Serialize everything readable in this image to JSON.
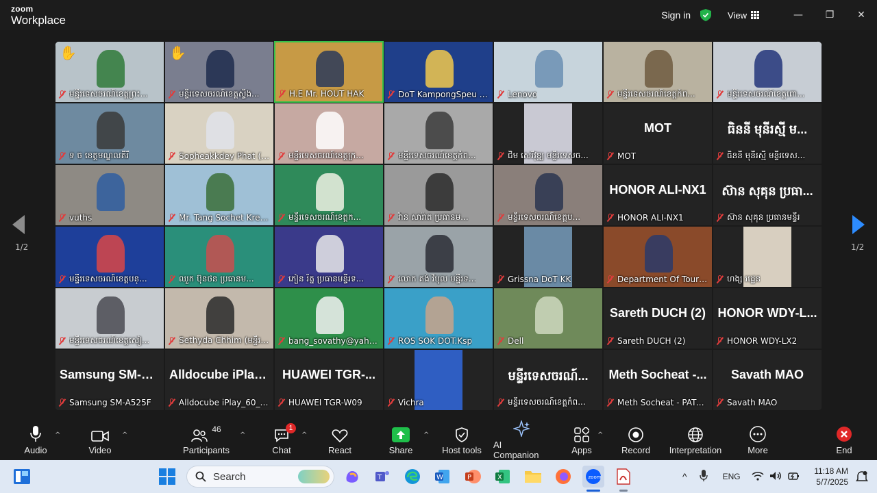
{
  "app": {
    "brand_small": "zoom",
    "brand_big": "Workplace",
    "sign_in": "Sign in",
    "view": "View"
  },
  "pager": {
    "left": "1/2",
    "right": "1/2"
  },
  "tiles": [
    {
      "name": "មន្ទីរទេសចរណ៍ខេត្តព្រះ...",
      "type": "video",
      "hand": true,
      "bg": "#b8c3c9",
      "pic": "#2f7a3a"
    },
    {
      "name": "មន្ទីរទេសចរណ៍ខេត្តស្ទឹង...",
      "type": "video",
      "hand": true,
      "bg": "#7a7e8f",
      "pic": "#1e2c4e"
    },
    {
      "name": "H.E Mr. HOUT HAK",
      "type": "video",
      "active": true,
      "bg": "#c79a45",
      "pic": "#2a3a5a"
    },
    {
      "name": "DoT KampongSpeu - ...",
      "type": "video",
      "bg": "#1f3f8a",
      "pic": "#f2c94c"
    },
    {
      "name": "Lenovo",
      "type": "video",
      "bg": "#c7d4dc",
      "pic": "#6b8fb3"
    },
    {
      "name": "មន្ទីរទេសចរណ៍ខេត្តកំព...",
      "type": "video",
      "bg": "#b9b2a0",
      "pic": "#6f5a40"
    },
    {
      "name": "មន្ទីរទេសចរណ៍ខេត្តពោ...",
      "type": "video",
      "bg": "#c7cdd4",
      "pic": "#23357a"
    },
    {
      "name": "ទ ច ខេត្តមណ្ឌលគិរី",
      "type": "video",
      "bg": "#6e8aa0",
      "pic": "#3a3a3a"
    },
    {
      "name": "Sopheakkdey Phat (Do...",
      "type": "video",
      "bg": "#d9d2c2",
      "pic": "#dfe3ea"
    },
    {
      "name": "មន្ទីរទេសចរណ៍ខេត្តក្រ...",
      "type": "video",
      "bg": "#c6a9a2",
      "pic": "#ffffff"
    },
    {
      "name": "មន្ទីរទេសចរណ៍ខេត្តកំព...",
      "type": "video",
      "bg": "#a9a9a9",
      "pic": "#3c3c3c"
    },
    {
      "name": "ជិម សេរីវុឌ្ឍ មន្ទីរទេសច...",
      "type": "portrait",
      "bg": "#232323",
      "pic": "#c9c9d3"
    },
    {
      "name": "MOT",
      "type": "text",
      "big": "MOT"
    },
    {
      "name": "ធិននី មុនីរស្មី មន្ទីរទេស...",
      "type": "text",
      "big": "ធិននី មុនីរស្មី ម..."
    },
    {
      "name": "vuths",
      "type": "video",
      "bg": "#8e8a84",
      "pic": "#2f5da0"
    },
    {
      "name": "Mr. Tang Sochet Kresna",
      "type": "video",
      "bg": "#9fc0d6",
      "pic": "#3b6e3a"
    },
    {
      "name": "មន្ទីរទេសចរណ៍ខេត្តក...",
      "type": "video",
      "bg": "#2f8a5a",
      "pic": "#eef1e4"
    },
    {
      "name": "វ៉ាន សារ៉ាត ប្រធានម...",
      "type": "video",
      "bg": "#9a9a9a",
      "pic": "#2b2b2b"
    },
    {
      "name": "មន្ទីរទេសចរណ៍ខេត្តប...",
      "type": "video",
      "bg": "#8a7f7a",
      "pic": "#2a3550"
    },
    {
      "name": "HONOR ALI-NX1",
      "type": "text",
      "big": "HONOR ALI-NX1"
    },
    {
      "name": "ស៊ាន សុគុន ប្រធានមន្ទីរ",
      "type": "text",
      "big": "ស៊ាន សុគុន ប្រធា..."
    },
    {
      "name": "មន្ទីរទេសចរណ៍ខេត្តបន្...",
      "type": "video",
      "bg": "#1e3f9a",
      "pic": "#d94646"
    },
    {
      "name": "ឈួក ប៊ុនថន ប្រធានម...",
      "type": "video",
      "bg": "#2a8f7a",
      "pic": "#c94f4f"
    },
    {
      "name": "ភៀន រ័ត្ន ប្រធានមន្ទីរទ...",
      "type": "video",
      "bg": "#3a3a8a",
      "pic": "#e9e9e9"
    },
    {
      "name": "លោក គង់ វិបុល មន្ទីរទ...",
      "type": "video",
      "bg": "#9aa3a8",
      "pic": "#2b2e36"
    },
    {
      "name": "Grissna DoT KK",
      "type": "portrait",
      "bg": "#232323",
      "pic": "#6a8aa5"
    },
    {
      "name": "Department Of Touris...",
      "type": "video",
      "bg": "#8a4a2a",
      "pic": "#2a3a6a"
    },
    {
      "name": "ហង្ស រដ្ឋេន",
      "type": "portrait",
      "bg": "#232323",
      "pic": "#d8cfc0"
    },
    {
      "name": "មន្ទីរទេសចរណ៍ខេត្តសៀ...",
      "type": "video",
      "bg": "#c8ccd0",
      "pic": "#4a4a52"
    },
    {
      "name": "Sethyda Chhim (មន្ទីរទ...",
      "type": "video",
      "bg": "#c3b9ac",
      "pic": "#2a2a2a"
    },
    {
      "name": "bang_sovathy@yahoo....",
      "type": "video",
      "bg": "#2e8f4a",
      "pic": "#f2f2f2"
    },
    {
      "name": "ROS SOK DOT.Ksp",
      "type": "video",
      "bg": "#3aa0c8",
      "pic": "#c9a38a"
    },
    {
      "name": "Dell",
      "type": "video",
      "bg": "#6f8a5a",
      "pic": "#cfd8c0"
    },
    {
      "name": "Sareth DUCH (2)",
      "type": "text",
      "big": "Sareth DUCH (2)"
    },
    {
      "name": "HONOR WDY-LX2",
      "type": "text",
      "big": "HONOR  WDY-L..."
    },
    {
      "name": "Samsung SM-A525F",
      "type": "text",
      "big": "Samsung  SM-A..."
    },
    {
      "name": "Alldocube iPlay_60_Lite",
      "type": "text",
      "big": "Alldocube  iPlay..."
    },
    {
      "name": "HUAWEI TGR-W09",
      "type": "text",
      "big": "HUAWEI  TGR-..."
    },
    {
      "name": "Vichra",
      "type": "portrait",
      "bg": "#232323",
      "pic": "#2f5ec2"
    },
    {
      "name": "មន្ទីរទេសចរណ៍ខេត្តកំព...",
      "type": "text",
      "big": "មន្ទីរទេសចរណ៍..."
    },
    {
      "name": "Meth Socheat - PATA ...",
      "type": "text",
      "big": "Meth  Socheat  -..."
    },
    {
      "name": "Savath MAO",
      "type": "text",
      "big": "Savath MAO"
    }
  ],
  "toolbar": {
    "audio": "Audio",
    "video": "Video",
    "participants": "Participants",
    "participants_count": "46",
    "chat": "Chat",
    "chat_badge": "1",
    "react": "React",
    "share": "Share",
    "host_tools": "Host tools",
    "ai_companion": "AI Companion",
    "apps": "Apps",
    "record": "Record",
    "interpretation": "Interpretation",
    "more": "More",
    "end": "End"
  },
  "taskbar": {
    "search_placeholder": "Search",
    "lang": "ENG",
    "time": "11:18 AM",
    "date": "5/7/2025"
  },
  "colors": {
    "share": "#1fbf4a",
    "end": "#e02828",
    "active_tile": "#35c24a",
    "arrow_next": "#2d8cff"
  }
}
